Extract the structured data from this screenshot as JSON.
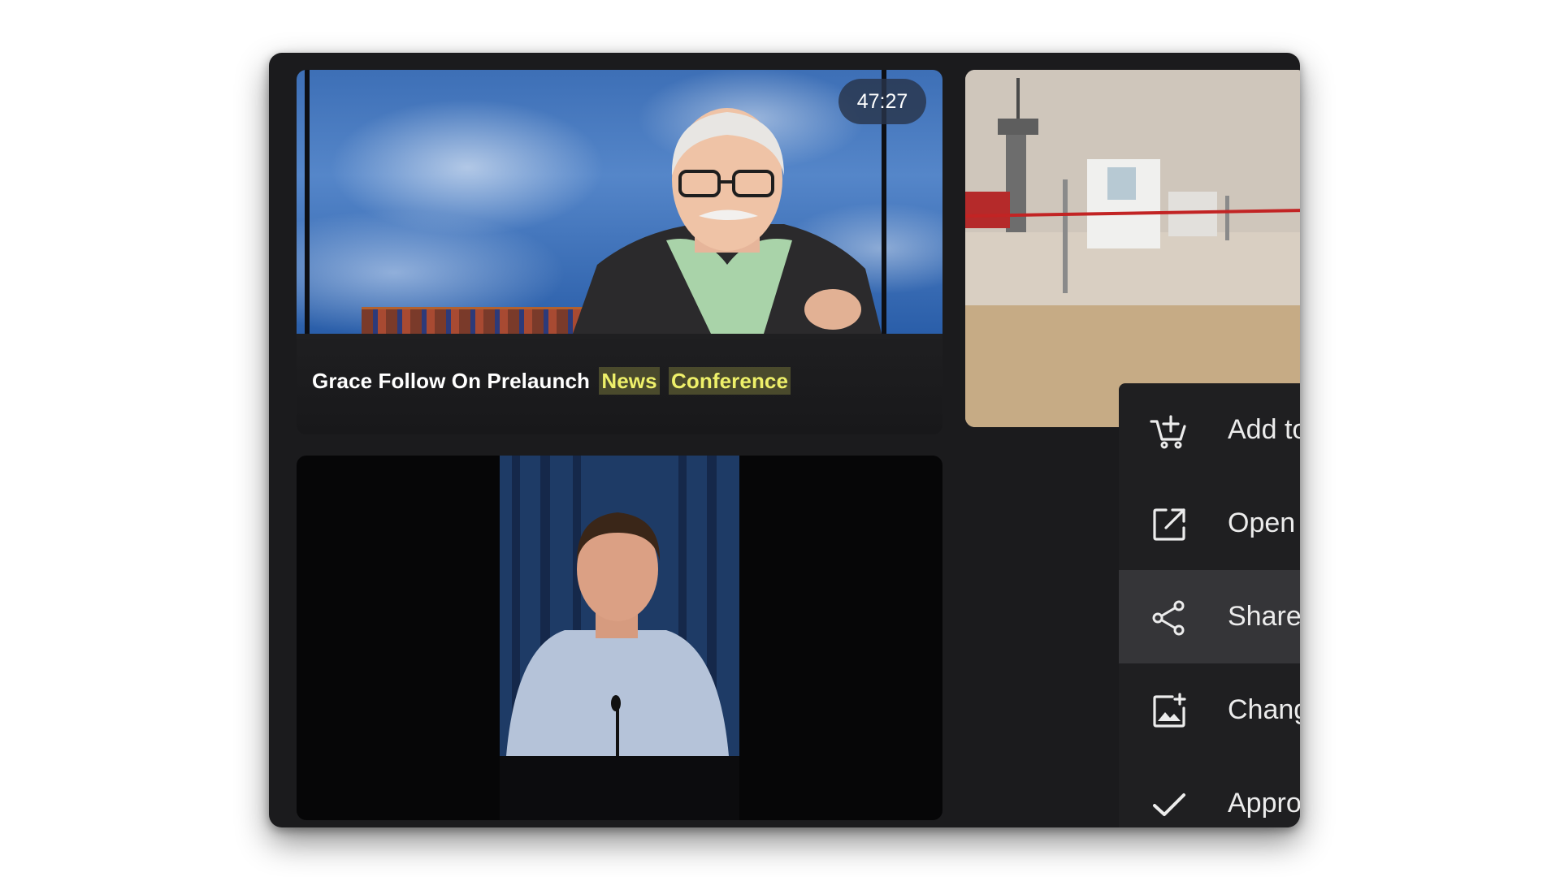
{
  "tiles": {
    "main": {
      "duration": "47:27",
      "title_plain": "Grace Follow On Prelaunch",
      "title_highlight_1": "News",
      "title_highlight_2": "Conference"
    }
  },
  "menu": {
    "items": [
      {
        "label": "Add to cart",
        "icon": "add-to-cart-icon"
      },
      {
        "label": "Open event",
        "icon": "open-external-icon"
      },
      {
        "label": "Share",
        "icon": "share-icon",
        "active": true
      },
      {
        "label": "Change thumbnail",
        "icon": "change-image-icon"
      },
      {
        "label": "Approve",
        "icon": "checkmark-icon"
      }
    ]
  },
  "colors": {
    "panel_bg": "#1b1b1d",
    "menu_bg": "#1f1f21",
    "menu_active_bg": "#353538",
    "highlight_text": "#eef06a",
    "highlight_bg": "#4a4a2c"
  }
}
